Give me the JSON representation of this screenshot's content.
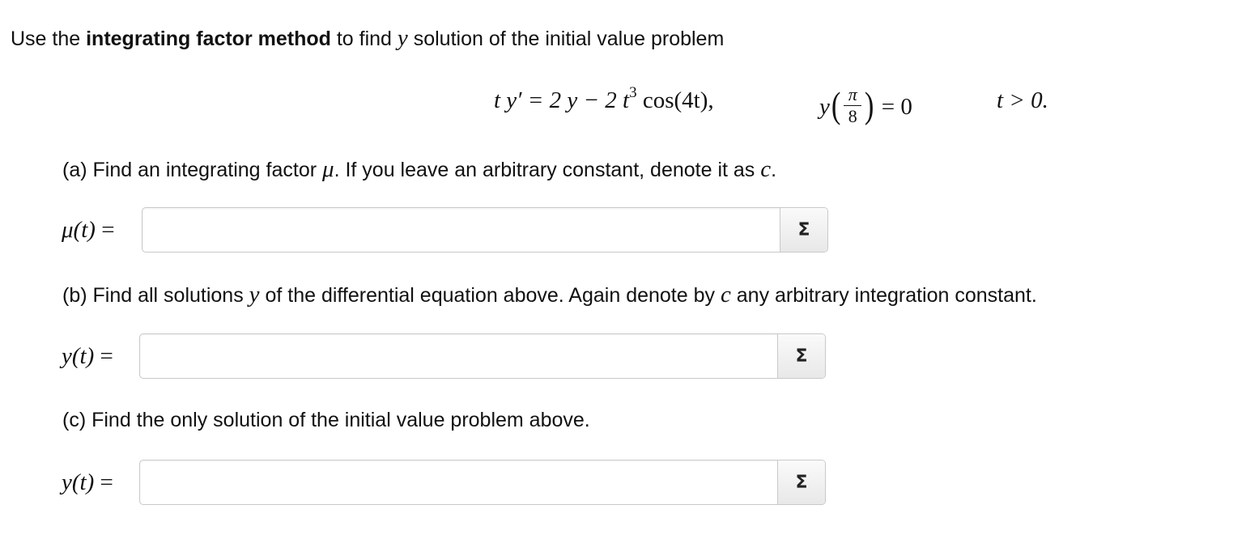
{
  "intro": {
    "prefix": "Use the ",
    "bold": "integrating factor method",
    "mid": " to find ",
    "var": "y",
    "suffix": " solution of the initial value problem"
  },
  "equation": {
    "lhs": "t y′ = 2 y − 2 t",
    "exp": "3",
    "rhs": " cos(4t),",
    "ic_var": "y",
    "ic_num": "π",
    "ic_den": "8",
    "ic_rhs": "= 0",
    "condition": "t > 0."
  },
  "parts": {
    "a": {
      "question_pre": "(a) Find an integrating factor ",
      "question_var": "μ",
      "question_post": ". If you leave an arbitrary constant, denote it as ",
      "question_const": "c",
      "question_end": ".",
      "label": "μ(t)",
      "equals": "=",
      "value": "",
      "button": "Σ"
    },
    "b": {
      "question_pre": "(b) Find all solutions ",
      "question_var": "y",
      "question_post": " of the differential equation above. Again denote by ",
      "question_const": "c",
      "question_end": " any arbitrary integration constant.",
      "label": "y(t)",
      "equals": "=",
      "value": "",
      "button": "Σ"
    },
    "c": {
      "question": "(c) Find the only solution of the initial value problem above.",
      "label": "y(t)",
      "equals": "=",
      "value": "",
      "button": "Σ"
    }
  }
}
